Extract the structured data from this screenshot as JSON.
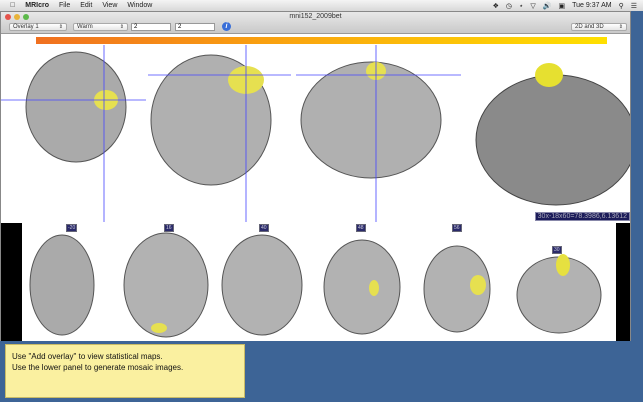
{
  "menubar": {
    "app": "MRIcro",
    "items": [
      "File",
      "Edit",
      "View",
      "Window"
    ],
    "clock": "Tue 9:37 AM"
  },
  "window": {
    "title": "mni152_2009bet"
  },
  "toolbar": {
    "overlay": "Overlay 1",
    "colormap": "Warm",
    "min": "2",
    "max": "2",
    "info": "i",
    "view_mode": "2D and 3D"
  },
  "colors": {
    "colorbar_start": "#f07020",
    "colorbar_end": "#ffe000",
    "overlay": "#e8e040"
  },
  "upper": {
    "coord_readout": "30x-18x60=78.3986,6.13612"
  },
  "mosaic": {
    "slices": [
      "-20",
      "16",
      "40",
      "48",
      "56",
      "30"
    ]
  },
  "tooltip": {
    "line1": "Use \"Add overlay\" to view statistical maps.",
    "line2": "Use the lower panel to generate mosaic images."
  }
}
